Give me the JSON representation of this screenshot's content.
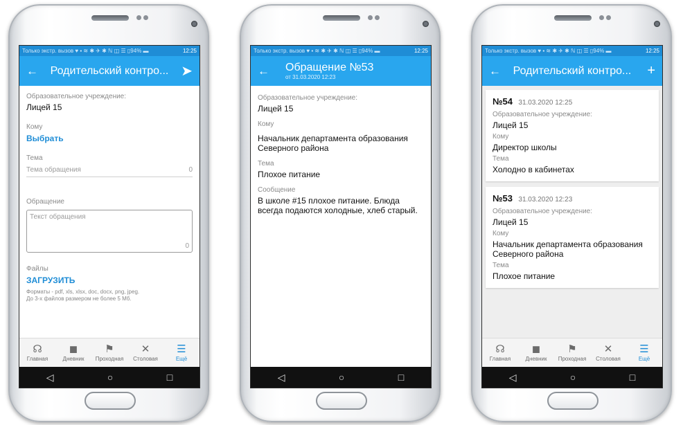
{
  "status": {
    "left": "Только экстр. вызов ♥ ▪ ≋ ✱ ✈ ✱ ℕ ◫ ☰ ▯94% ▬",
    "time": "12:25"
  },
  "tabs": [
    {
      "label": "Главная",
      "icon": "☊"
    },
    {
      "label": "Дневник",
      "icon": "◼"
    },
    {
      "label": "Проходная",
      "icon": "⚑"
    },
    {
      "label": "Столовая",
      "icon": "✕"
    },
    {
      "label": "Ещё",
      "icon": "☰"
    }
  ],
  "nav": {
    "back": "◁",
    "home": "○",
    "recent": "□"
  },
  "phone1": {
    "title": "Родительский контро...",
    "back_icon": "←",
    "send_icon": "➤",
    "institution_label": "Образовательное учреждение:",
    "institution_value": "Лицей 15",
    "to_label": "Кому",
    "to_action": "Выбрать",
    "topic_label": "Тема",
    "topic_placeholder": "Тема обращения",
    "topic_counter": "0",
    "message_label": "Обращение",
    "message_placeholder": "Текст обращения",
    "message_counter": "0",
    "files_label": "Файлы",
    "upload_action": "ЗАГРУЗИТЬ",
    "formats_hint_1": "Форматы - pdf, xls, xlsx, doc, docx, png, jpeg.",
    "formats_hint_2": "До 3-х файлов размером не более 5 Мб."
  },
  "phone2": {
    "title": "Обращение №53",
    "subtitle": "от 31.03.2020 12:23",
    "back_icon": "←",
    "institution_label": "Образовательное учреждение:",
    "institution_value": "Лицей 15",
    "to_label": "Кому",
    "to_value": "Начальник департамента образования Северного района",
    "topic_label": "Тема",
    "topic_value": "Плохое питание",
    "message_label": "Сообщение",
    "message_value": "В школе #15 плохое питание. Блюда всегда подаются холодные, хлеб старый."
  },
  "phone3": {
    "title": "Родительский контро...",
    "back_icon": "←",
    "add_icon": "+",
    "cards": [
      {
        "number": "№54",
        "date": "31.03.2020 12:25",
        "institution_label": "Образовательное учреждение:",
        "institution_value": "Лицей 15",
        "to_label": "Кому",
        "to_value": "Директор школы",
        "topic_label": "Тема",
        "topic_value": "Холодно в кабинетах"
      },
      {
        "number": "№53",
        "date": "31.03.2020 12:23",
        "institution_label": "Образовательное учреждение:",
        "institution_value": "Лицей 15",
        "to_label": "Кому",
        "to_value": "Начальник департамента образования Северного района",
        "topic_label": "Тема",
        "topic_value": "Плохое питание"
      }
    ]
  }
}
